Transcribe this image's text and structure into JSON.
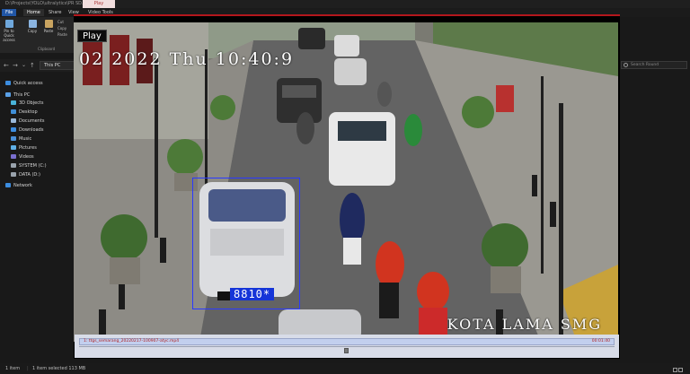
{
  "window": {
    "title": "D:\\Projects\\YOLO\\ultralytics\\PR SD...",
    "play_tab": "Play"
  },
  "ribbon": {
    "tabs": [
      "File",
      "Home",
      "Share",
      "View",
      "Video Tools"
    ],
    "pin_label": "Pin to Quick access",
    "copy_label": "Copy",
    "paste_label": "Paste",
    "small_cut": "Cut",
    "small_copy": "Copy",
    "small_paste": "Paste",
    "group_label": "Clipboard"
  },
  "address": {
    "path": "This PC",
    "back": "←",
    "forward": "→",
    "down": "⌄",
    "up": "↑"
  },
  "search": {
    "placeholder": "Search Round"
  },
  "nav": {
    "quick_access": "Quick access",
    "this_pc": "This PC",
    "items": [
      "3D Objects",
      "Desktop",
      "Documents",
      "Downloads",
      "Music",
      "Pictures",
      "Videos",
      "SYSTEM (C:)",
      "DATA (D:)"
    ],
    "network": "Network"
  },
  "player": {
    "play_tooltip": "Play",
    "osd_timestamp": "02 2022 Thu 10:40:9",
    "osd_location": "KOTA LAMA SMG",
    "detection_label": "8810*",
    "timeline_file": "1: ttgs_semarang_20220217-100907-atyc.mp4",
    "timeline_duration": "00:01:40",
    "progress": 0.5
  },
  "status": {
    "items": "1 item",
    "selected": "1 item selected  113 MB"
  },
  "colors": {
    "accent_file": "#2156a5",
    "detection_box": "#2a39ff",
    "progress_red": "#b3161c"
  }
}
